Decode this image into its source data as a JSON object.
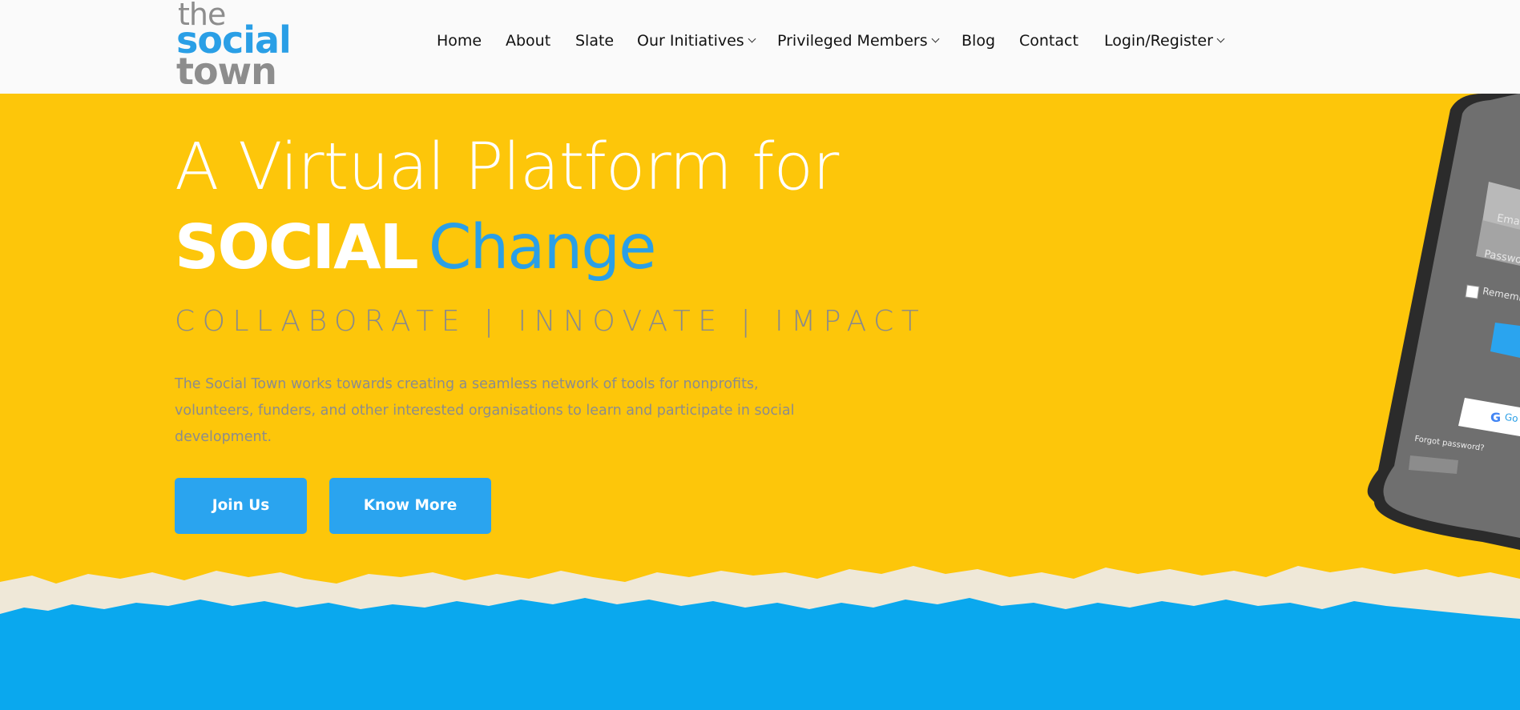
{
  "logo": {
    "line1": "the",
    "line2": "social",
    "line3": "town"
  },
  "nav": {
    "items": [
      {
        "label": "Home"
      },
      {
        "label": "About"
      },
      {
        "label": "Slate"
      },
      {
        "label": "Our Initiatives",
        "dropdown": true
      },
      {
        "label": "Privileged Members",
        "dropdown": true
      },
      {
        "label": "Blog"
      },
      {
        "label": "Contact"
      },
      {
        "label": "Login/Register",
        "dropdown": true
      }
    ]
  },
  "hero": {
    "headline_line1": "A Virtual Platform for",
    "headline_bold": "SOCIAL",
    "headline_accent": "Change",
    "tagline": "COLLABORATE | INNOVATE | IMPACT",
    "description": "The Social Town works towards creating a seamless network of tools for nonprofits, volunteers, funders, and other interested organisations to learn and participate in social development.",
    "buttons": {
      "join": "Join Us",
      "know_more": "Know More"
    }
  },
  "phone": {
    "email_placeholder": "Emai",
    "password_placeholder": "Passwo",
    "remember_label": "Rememb",
    "google_label": "Go",
    "forgot_password": "Forgot password?"
  },
  "colors": {
    "yellow": "#fdc60a",
    "accent_blue": "#2a9fe6",
    "button_blue": "#2aa4ef",
    "sky_blue": "#0aa8ee",
    "paper": "#efe8d8"
  }
}
